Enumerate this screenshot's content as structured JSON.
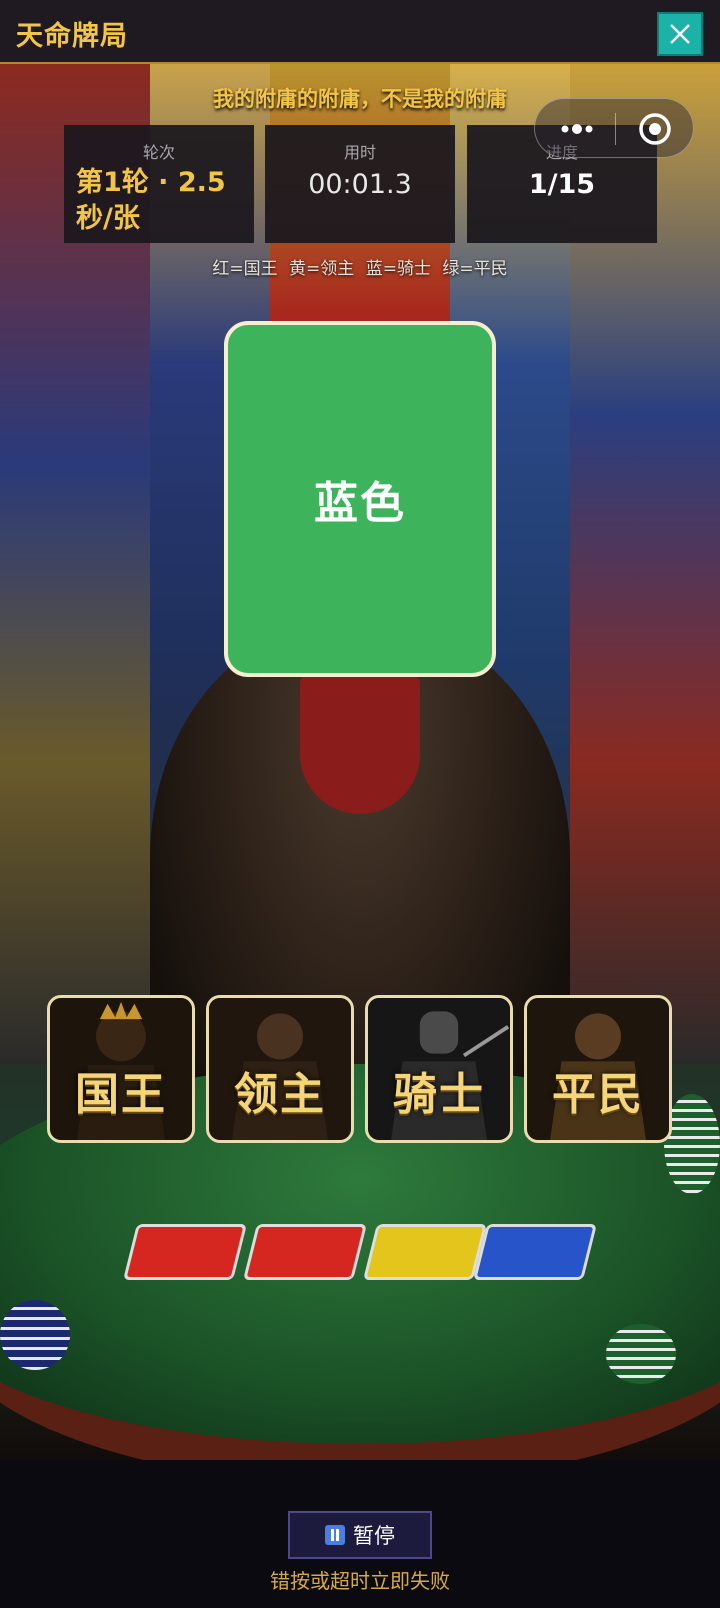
{
  "header": {
    "title": "天命牌局",
    "close_icon": "close-icon"
  },
  "rule_text": "我的附庸的附庸，不是我的附庸",
  "stats": {
    "round": {
      "label": "轮次",
      "value": "第1轮 · 2.5秒/张"
    },
    "time": {
      "label": "用时",
      "value": "00:01.3"
    },
    "progress": {
      "label": "进度",
      "value": "1/15"
    }
  },
  "capsule": {
    "more_icon": "more-dots-icon",
    "close_icon": "target-icon"
  },
  "legend": "红=国王  黄=领主  蓝=骑士  绿=平民",
  "card": {
    "text": "蓝色",
    "color": "#3db35c"
  },
  "answers": [
    {
      "label": "国王",
      "icon": "king-icon"
    },
    {
      "label": "领主",
      "icon": "lord-icon"
    },
    {
      "label": "骑士",
      "icon": "knight-icon"
    },
    {
      "label": "平民",
      "icon": "commoner-icon"
    }
  ],
  "pause": {
    "label": "暂停",
    "icon": "pause-icon"
  },
  "warning": "错按或超时立即失败",
  "colors": {
    "accent": "#f3c547",
    "close_bg": "#1bb2a8",
    "card_green": "#3db35c",
    "pause_bg": "#1c1b3e"
  }
}
